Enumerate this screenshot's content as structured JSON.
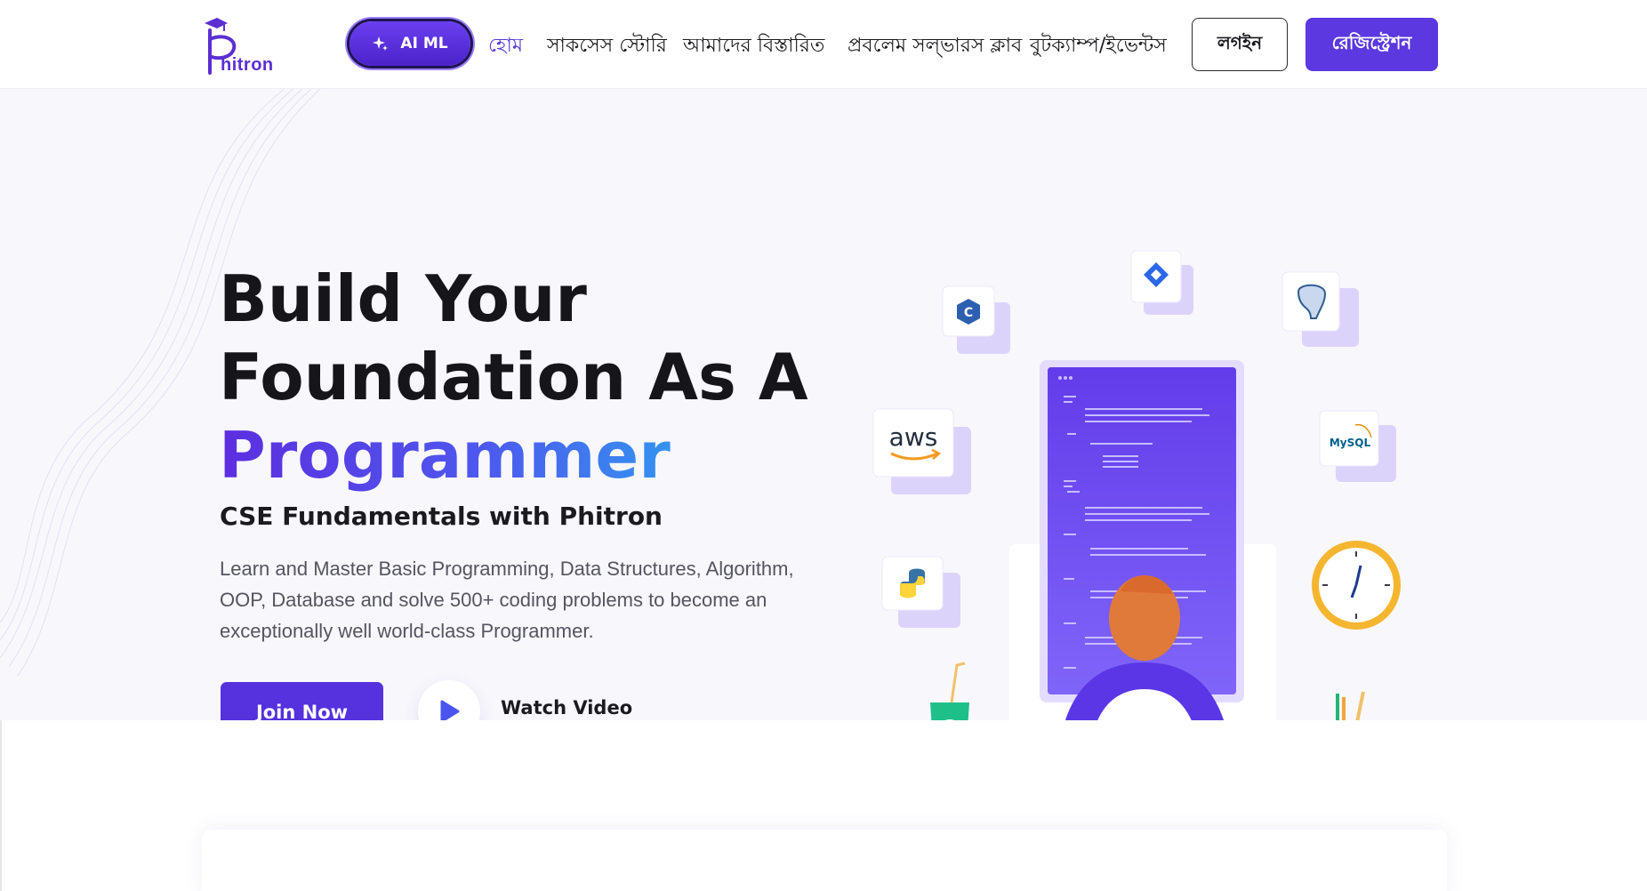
{
  "brand": {
    "name": "hitron",
    "initial": "P",
    "color": "#5b2fd3"
  },
  "header": {
    "aiml_label": "AI ML",
    "nav": [
      {
        "label": "হোম",
        "active": true
      },
      {
        "label": "সাকসেস স্টোরি",
        "active": false
      },
      {
        "label": "আমাদের বিস্তারিত",
        "active": false
      },
      {
        "label": "প্রবলেম সল্ভারস ক্লাব",
        "active": false
      },
      {
        "label": "বুটক্যাম্প/ইভেন্টস",
        "active": false
      }
    ],
    "login_label": "লগইন",
    "register_label": "রেজিস্ট্রেশন"
  },
  "hero": {
    "title_line1": "Build Your",
    "title_line2": "Foundation As A",
    "title_line3": "Programmer",
    "subtitle": "CSE Fundamentals with Phitron",
    "description": "Learn and Master Basic Programming, Data Structures, Algorithm, OOP, Database and solve 500+ coding problems to become an exceptionally well world-class Programmer.",
    "join_label": "Join Now",
    "watch_label": "Watch Video"
  },
  "illustration": {
    "tech_icons": [
      "c-plus-plus-icon",
      "jira-icon",
      "postgresql-icon",
      "aws-icon",
      "mysql-icon",
      "python-icon",
      "clock-icon"
    ],
    "aws_text": "aws",
    "mysql_text": "MySQL"
  },
  "colors": {
    "primary": "#5b38e0",
    "accent": "#22bdf0",
    "background": "#f8f7fc"
  }
}
